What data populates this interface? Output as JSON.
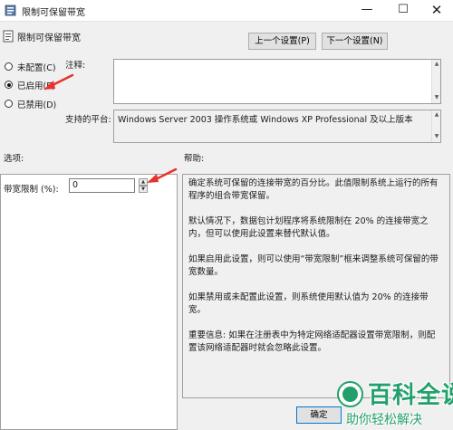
{
  "window": {
    "title": "限制可保留带宽",
    "minimize_glyph": "—",
    "maximize_glyph": "☐",
    "close_glyph": "✕"
  },
  "header": {
    "setting_title": "限制可保留带宽",
    "prev_button": "上一个设置(P)",
    "next_button": "下一个设置(N)"
  },
  "state_options": [
    {
      "label": "未配置(C)",
      "selected": false
    },
    {
      "label": "已启用(E)",
      "selected": true
    },
    {
      "label": "已禁用(D)",
      "selected": false
    }
  ],
  "comment": {
    "label": "注释:",
    "value": ""
  },
  "supported_on": {
    "label": "支持的平台:",
    "value": "Windows Server 2003 操作系统或 Windows XP Professional 及以上版本"
  },
  "options": {
    "section_label": "选项:",
    "bandwidth_label": "带宽限制 (%):",
    "bandwidth_value": "0"
  },
  "help": {
    "section_label": "帮助:",
    "paragraphs": [
      "确定系统可保留的连接带宽的百分比。此值限制系统上运行的所有程序的组合带宽保留。",
      "默认情况下，数据包计划程序将系统限制在 20% 的连接带宽之内，但可以使用此设置来替代默认值。",
      "如果启用此设置，则可以使用“带宽限制”框来调整系统可保留的带宽数量。",
      "如果禁用或未配置此设置，则系统使用默认值为 20% 的连接带宽。",
      "重要信息: 如果在注册表中为特定网络适配器设置带宽限制，则配置该网络适配器时就会忽略此设置。"
    ]
  },
  "footer": {
    "ok_button": "确定"
  },
  "watermark": {
    "title": "百科全说",
    "subtitle": "助你轻松解决"
  },
  "colors": {
    "annotation_arrow": "#e8322a",
    "watermark_green": "#22a06b"
  }
}
